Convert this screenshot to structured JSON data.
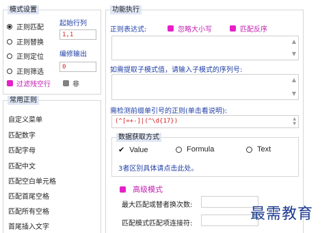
{
  "mode_settings": {
    "title": "模式设置",
    "options": [
      "正则匹配",
      "正则替换",
      "正则定位",
      "正则筛选"
    ],
    "selected_index": 0,
    "start_row_label": "起始行列",
    "start_row_value": "1,1",
    "edit_output_label": "编修输出",
    "edit_output_value": "0",
    "filter_blank_label": "过滤残空行",
    "not_label": "非"
  },
  "common_regex": {
    "title": "常用正则",
    "items": [
      "自定义菜单",
      "匹配数字",
      "匹配字母",
      "匹配中文",
      "匹配空白单元格",
      "匹配首尾空格",
      "匹配所有空格",
      "首尾插入文字"
    ]
  },
  "function_exec": {
    "title": "功能执行",
    "regex_label": "正则表达式:",
    "ignore_case_label": "忽略大小写",
    "match_reverse_label": "匹配反序",
    "submatch_label": "如需提取子模式值，请输入子模式的序列号:",
    "prefix_label": "需检测前缀单引号的正则(单击看说明):",
    "prefix_value": "(^[=+-]|(^\\d{17})"
  },
  "data_fetch": {
    "title": "数据获取方式",
    "options": [
      "Value",
      "Formula",
      "Text"
    ],
    "selected_index": 0,
    "hint": "3者区别具体请点击此处。"
  },
  "advanced": {
    "title": "高级模式",
    "max_match_label": "最大匹配或替者换次数:",
    "connector_label": "匹配模式匹配项连接符:"
  },
  "watermark": "最需教育",
  "colors": {
    "accent_magenta": "#e620c8",
    "link_blue": "#1f3fa6",
    "value_red": "#d02020"
  }
}
